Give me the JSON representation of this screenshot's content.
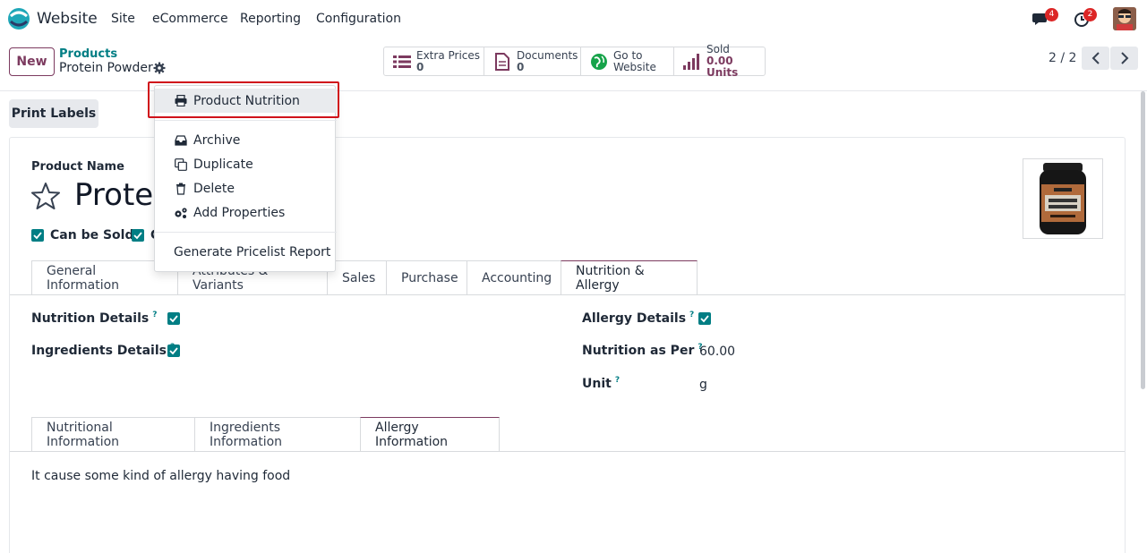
{
  "navbar": {
    "app_name": "Website",
    "menu": [
      "Site",
      "eCommerce",
      "Reporting",
      "Configuration"
    ],
    "messages_badge": "4",
    "activity_badge": "2"
  },
  "control_panel": {
    "new_label": "New",
    "breadcrumb_parent": "Products",
    "breadcrumb_current": "Protein Powder",
    "smart_buttons": [
      {
        "label": "Extra Prices",
        "value": "0",
        "icon": "list-icon"
      },
      {
        "label": "Documents",
        "value": "0",
        "icon": "document-icon"
      },
      {
        "label": "Go to",
        "value": "Website",
        "icon": "globe-icon"
      },
      {
        "label": "Sold",
        "value": "0.00 Units",
        "icon": "bar-chart-icon"
      }
    ],
    "pager": "2 / 2"
  },
  "form": {
    "print_labels": "Print Labels",
    "product_name_label": "Product Name",
    "product_name_visible": "Protei",
    "can_be_sold": "Can be Sold",
    "can_be_purchased_visible": "C",
    "tabs": [
      "General Information",
      "Attributes & Variants",
      "Sales",
      "Purchase",
      "Accounting",
      "Nutrition & Allergy"
    ],
    "active_tab": "Nutrition & Allergy",
    "fields": {
      "nutrition_details": "Nutrition Details",
      "ingredients_details": "Ingredients Details",
      "allergy_details": "Allergy Details",
      "nutrition_as_per": "Nutrition as Per",
      "nutrition_as_per_value": "60.00",
      "unit": "Unit",
      "unit_value": "g",
      "help": "?"
    },
    "subtabs": [
      "Nutritional Information",
      "Ingredients Information",
      "Allergy Information"
    ],
    "active_subtab": "Allergy Information",
    "allergy_text": "It cause some kind of allergy having food"
  },
  "dropdown": {
    "items": [
      "Product Nutrition",
      "Archive",
      "Duplicate",
      "Delete",
      "Add Properties",
      "Generate Pricelist Report"
    ]
  },
  "colors": {
    "brand": "#7c3a5f",
    "teal": "#017e84",
    "highlight": "#d0121b"
  }
}
